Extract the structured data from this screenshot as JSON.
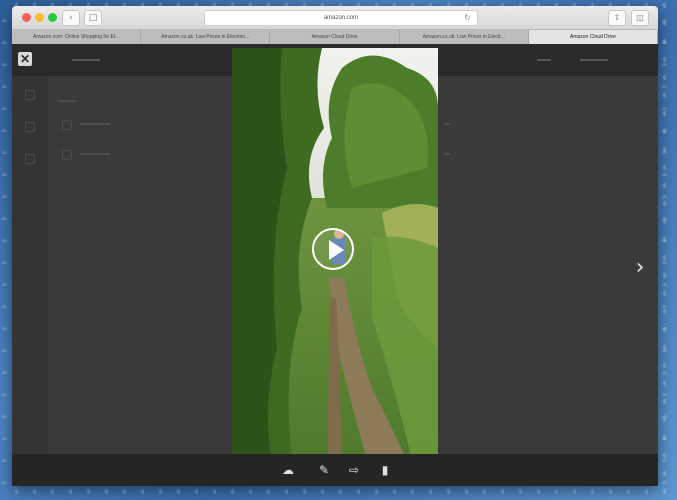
{
  "browser": {
    "address": "amazon.com",
    "tabs": [
      {
        "label": "Amazon.com: Online Shopping for El...",
        "active": false
      },
      {
        "label": "Amazon.co.uk: Low Prices in Electron...",
        "active": false
      },
      {
        "label": "Amazon Cloud Drive",
        "active": false
      },
      {
        "label": "Amazon.co.uk: Low Prices in Electr...",
        "active": false
      },
      {
        "label": "Amazon Cloud Drive",
        "active": true
      }
    ]
  },
  "viewer": {
    "media_type": "video",
    "toolbar": [
      "download-icon",
      "edit-icon",
      "share-icon",
      "trash-icon"
    ]
  },
  "colors": {
    "overlay": "#3d3d3d",
    "toolbar": "#252525",
    "accent": "#ffffff"
  }
}
